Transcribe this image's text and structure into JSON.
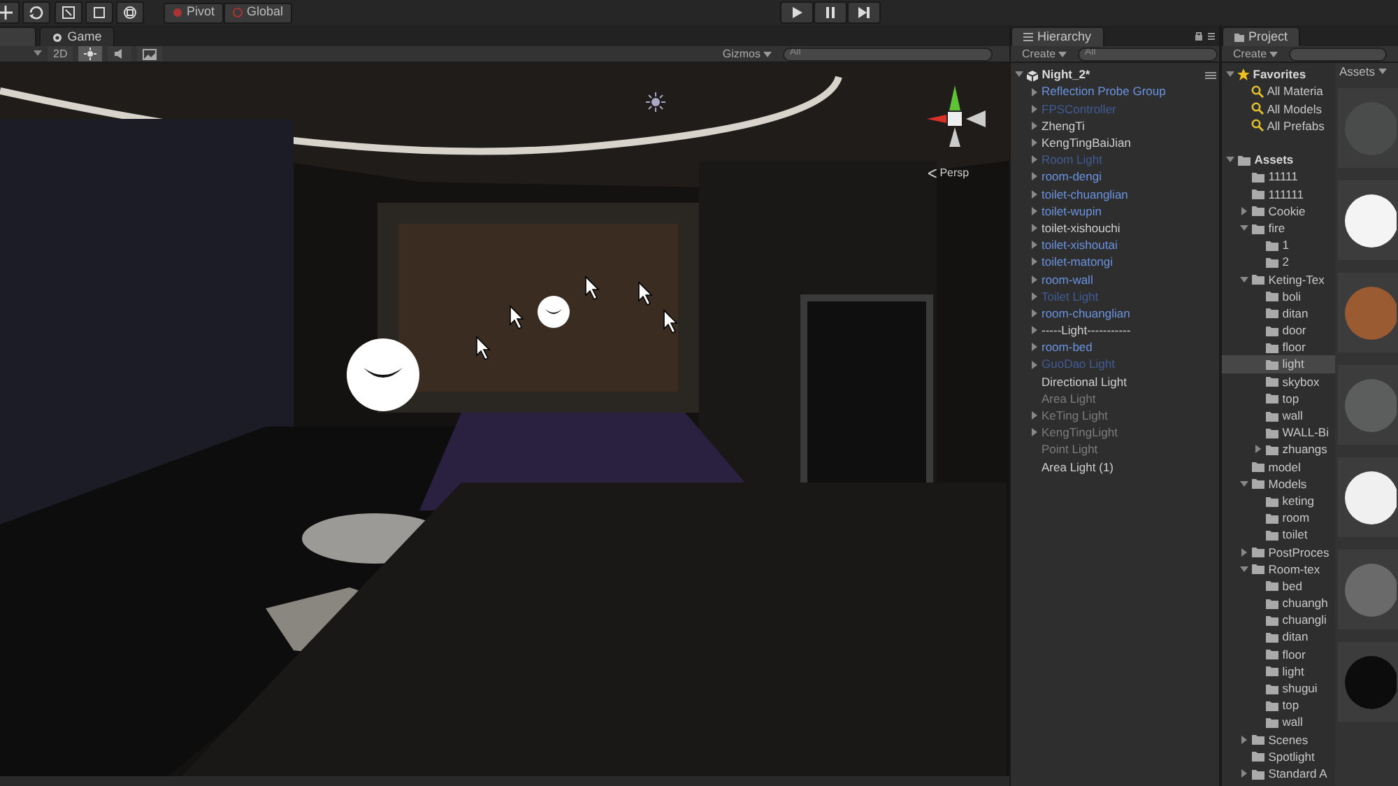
{
  "toolbar": {
    "pivot": "Pivot",
    "global": "Global"
  },
  "scene": {
    "tabs": [
      {
        "selected": true
      },
      {
        "label": "Game",
        "selected": false
      }
    ],
    "mode_2d": "2D",
    "toggles": [
      {
        "kind": "lighting",
        "on": true
      },
      {
        "kind": "audio",
        "on": false
      },
      {
        "kind": "effects",
        "on": false
      }
    ],
    "gizmos": "Gizmos",
    "search_placeholder": "All",
    "view_label": "Persp"
  },
  "hierarchy": {
    "title": "Hierarchy",
    "create": "Create",
    "search_placeholder": "All",
    "scene": {
      "name": "Night_2*",
      "expanded": true,
      "children": [
        {
          "name": "Reflection Probe Group",
          "prefab": true,
          "active": true,
          "expanded": false
        },
        {
          "name": "FPSController",
          "prefab": true,
          "active": false,
          "expanded": false
        },
        {
          "name": "ZhengTi",
          "prefab": false,
          "active": true,
          "expanded": false
        },
        {
          "name": "KengTingBaiJian",
          "prefab": false,
          "active": true,
          "expanded": false
        },
        {
          "name": "Room Light",
          "prefab": true,
          "active": false,
          "expanded": false
        },
        {
          "name": "room-dengi",
          "prefab": true,
          "active": true,
          "expanded": false
        },
        {
          "name": "toilet-chuanglian",
          "prefab": true,
          "active": true,
          "expanded": false
        },
        {
          "name": "toilet-wupin",
          "prefab": true,
          "active": true,
          "expanded": false
        },
        {
          "name": "toilet-xishouchi",
          "prefab": false,
          "active": true,
          "expanded": false
        },
        {
          "name": "toilet-xishoutai",
          "prefab": true,
          "active": true,
          "expanded": false
        },
        {
          "name": "toilet-matongi",
          "prefab": true,
          "active": true,
          "expanded": false
        },
        {
          "name": "room-wall",
          "prefab": true,
          "active": true,
          "expanded": false
        },
        {
          "name": "Toilet Light",
          "prefab": true,
          "active": false,
          "expanded": false
        },
        {
          "name": "room-chuanglian",
          "prefab": true,
          "active": true,
          "expanded": false
        },
        {
          "name": "-----Light-----------",
          "prefab": false,
          "active": true,
          "expanded": false
        },
        {
          "name": "room-bed",
          "prefab": true,
          "active": true,
          "expanded": false
        },
        {
          "name": "GuoDao Light",
          "prefab": true,
          "active": false,
          "expanded": false
        },
        {
          "name": "Directional Light",
          "prefab": false,
          "active": true
        },
        {
          "name": "Area Light",
          "prefab": false,
          "active": false
        },
        {
          "name": "KeTing Light",
          "prefab": false,
          "active": false,
          "expanded": false
        },
        {
          "name": "KengTingLight",
          "prefab": false,
          "active": false,
          "expanded": false
        },
        {
          "name": "Point Light",
          "prefab": false,
          "active": false
        },
        {
          "name": "Area Light (1)",
          "prefab": false,
          "active": true
        }
      ]
    }
  },
  "project": {
    "title": "Project",
    "create": "Create",
    "breadcrumb": "Assets",
    "favorites": {
      "name": "Favorites",
      "expanded": true,
      "children": [
        {
          "name": "All Materia"
        },
        {
          "name": "All Models"
        },
        {
          "name": "All Prefabs"
        }
      ]
    },
    "assets": {
      "name": "Assets",
      "expanded": true,
      "selected": false,
      "children": [
        {
          "name": "11111",
          "selected": false
        },
        {
          "name": "111111",
          "selected": false
        },
        {
          "name": "Cookie",
          "expanded": false,
          "selected": false
        },
        {
          "name": "fire",
          "expanded": true,
          "selected": false,
          "children": [
            {
              "name": "1",
              "selected": false
            },
            {
              "name": "2",
              "selected": false
            }
          ]
        },
        {
          "name": "Keting-Tex",
          "expanded": true,
          "selected": false,
          "children": [
            {
              "name": "boli",
              "selected": false
            },
            {
              "name": "ditan",
              "selected": false
            },
            {
              "name": "door",
              "selected": false
            },
            {
              "name": "floor",
              "selected": false
            },
            {
              "name": "light",
              "selected": true
            },
            {
              "name": "skybox",
              "selected": false
            },
            {
              "name": "top",
              "selected": false
            },
            {
              "name": "wall",
              "selected": false
            },
            {
              "name": "WALL-Bi",
              "selected": false
            },
            {
              "name": "zhuangs",
              "expanded": false,
              "selected": false
            }
          ]
        },
        {
          "name": "model",
          "selected": false
        },
        {
          "name": "Models",
          "expanded": true,
          "selected": false,
          "children": [
            {
              "name": "keting",
              "selected": false
            },
            {
              "name": "room",
              "selected": false
            },
            {
              "name": "toilet",
              "selected": false
            }
          ]
        },
        {
          "name": "PostProces",
          "expanded": false,
          "selected": false
        },
        {
          "name": "Room-tex",
          "expanded": true,
          "selected": false,
          "children": [
            {
              "name": "bed",
              "selected": false
            },
            {
              "name": "chuangh",
              "selected": false
            },
            {
              "name": "chuangli",
              "selected": false
            },
            {
              "name": "ditan",
              "selected": false
            },
            {
              "name": "floor",
              "selected": false
            },
            {
              "name": "light",
              "selected": false
            },
            {
              "name": "shugui",
              "selected": false
            },
            {
              "name": "top",
              "selected": false
            },
            {
              "name": "wall",
              "selected": false
            }
          ]
        },
        {
          "name": "Scenes",
          "expanded": false,
          "selected": false
        },
        {
          "name": "Spotlight",
          "selected": false
        },
        {
          "name": "Standard A",
          "expanded": false,
          "selected": false
        }
      ]
    },
    "thumbnails": [
      {
        "color": "#4a4c4c"
      },
      {
        "color": "#f4f4f4"
      },
      {
        "color": "#9a5a32"
      },
      {
        "color": "#5c5e5e"
      },
      {
        "color": "#f0f0f0"
      },
      {
        "color": "#6a6a6a"
      },
      {
        "color": "#0c0c0c"
      }
    ]
  }
}
